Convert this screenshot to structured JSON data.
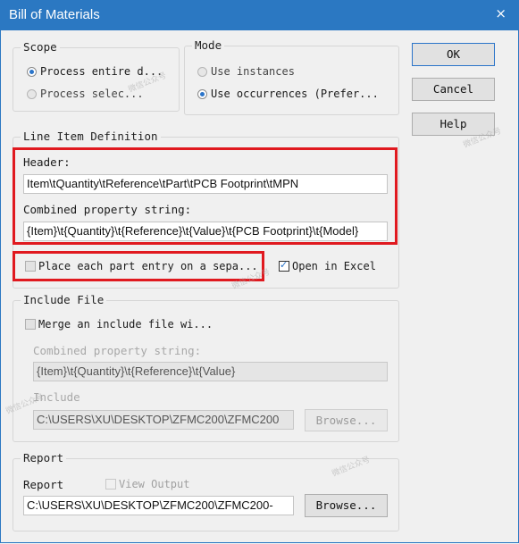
{
  "window": {
    "title": "Bill of Materials",
    "close_glyph": "×"
  },
  "scope": {
    "legend": "Scope",
    "process_entire": "Process entire d...",
    "process_selection": "Process selec..."
  },
  "mode": {
    "legend": "Mode",
    "use_instances": "Use instances",
    "use_occurrences": "Use occurrences (Prefer..."
  },
  "buttons": {
    "ok": "OK",
    "cancel": "Cancel",
    "help": "Help"
  },
  "line_item": {
    "legend": "Line Item Definition",
    "header_label": "Header:",
    "header_value": "Item\\tQuantity\\tReference\\tPart\\tPCB Footprint\\tMPN",
    "combined_label": "Combined property string:",
    "combined_value": "{Item}\\t{Quantity}\\t{Reference}\\t{Value}\\t{PCB Footprint}\\t{Model}",
    "place_each": "Place each part entry on a sepa...",
    "open_excel": "Open in Excel"
  },
  "include_file": {
    "legend": "Include File",
    "merge": "Merge an include file wi...",
    "combined_label": "Combined property string:",
    "combined_value": "{Item}\\t{Quantity}\\t{Reference}\\t{Value}",
    "include_label": "Include",
    "path": "C:\\USERS\\XU\\DESKTOP\\ZFMC200\\ZFMC200",
    "browse": "Browse..."
  },
  "report": {
    "legend": "Report",
    "report_label": "Report",
    "view_output": "View Output",
    "path": "C:\\USERS\\XU\\DESKTOP\\ZFMC200\\ZFMC200-",
    "browse": "Browse..."
  },
  "watermark": "微信公众号",
  "colors": {
    "titlebar": "#2b78c2",
    "highlight": "#e0191f",
    "accent": "#2a74c9"
  }
}
